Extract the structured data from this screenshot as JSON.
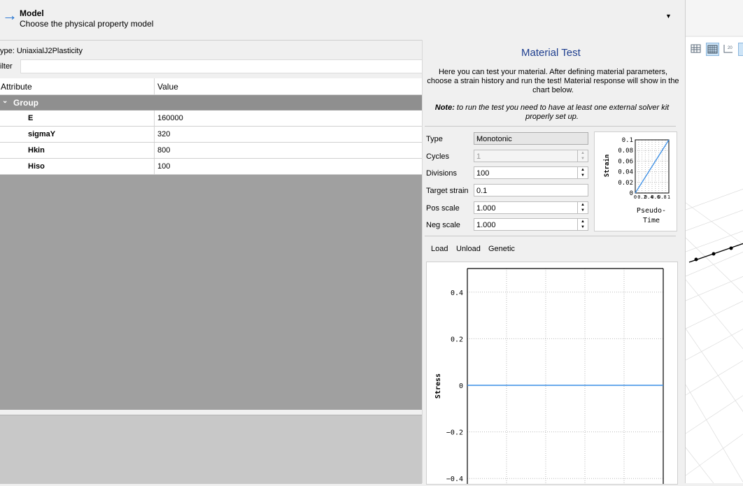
{
  "header": {
    "title": "Model",
    "subtitle": "Choose the physical property model",
    "arrow_icon": "arrow-right-icon",
    "collapse_icon": "chevron-down-icon"
  },
  "left": {
    "type_label": "ype:  UniaxialJ2Plasticity",
    "filter_label": "ilter",
    "filter_value": "",
    "columns": [
      "Attribute",
      "Value"
    ],
    "group_label": "Group",
    "rows": [
      {
        "name": "E",
        "value": "160000"
      },
      {
        "name": "sigmaY",
        "value": "320"
      },
      {
        "name": "Hkin",
        "value": "800"
      },
      {
        "name": "Hiso",
        "value": "100"
      }
    ]
  },
  "test": {
    "title": "Material Test",
    "description": "Here you can test your material. After defining material parameters, choose a strain history and run the test! Material response will show in the chart below.",
    "note_bold": "Note:",
    "note_text": " to run the test you need to have at least one external solver kit properly set up.",
    "fields": {
      "type_label": "Type",
      "type_value": "Monotonic",
      "cycles_label": "Cycles",
      "cycles_value": "1",
      "divisions_label": "Divisions",
      "divisions_value": "100",
      "target_label": "Target strain",
      "target_value": "0.1",
      "pos_label": "Pos scale",
      "pos_value": "1.000",
      "neg_label": "Neg scale",
      "neg_value": "1.000"
    },
    "buttons": [
      "Load",
      "Unload",
      "Genetic"
    ]
  },
  "chart_data": [
    {
      "type": "line",
      "title": "",
      "xlabel": "Pseudo-Time",
      "ylabel": "Strain",
      "ylim": [
        0,
        0.1
      ],
      "xlim": [
        0,
        1
      ],
      "y_ticks": [
        "0",
        "0.02",
        "0.04",
        "0.06",
        "0.08",
        "0.1"
      ],
      "x_ticks": [
        "0",
        "0.2",
        "0.4",
        "0.6",
        "0.8",
        "1"
      ],
      "series": [
        {
          "x": [
            0,
            1
          ],
          "y": [
            0,
            0.1
          ]
        }
      ],
      "grid": true,
      "color": "#3a8ee6"
    },
    {
      "type": "line",
      "title": "",
      "xlabel": "",
      "ylabel": "Stress",
      "ylim": [
        -0.5,
        0.5
      ],
      "xlim": [
        0,
        1
      ],
      "y_ticks": [
        "0.4",
        "0.2",
        "0",
        "−0.2",
        "−0.4"
      ],
      "series": [
        {
          "x": [
            0,
            1
          ],
          "y": [
            0,
            0
          ]
        }
      ],
      "grid": true,
      "color": "#3a8ee6"
    }
  ],
  "viewport": {
    "toolbar_icons": [
      "grid-icon",
      "grid-fine-icon",
      "grid-2d-icon",
      "view-icon"
    ]
  }
}
